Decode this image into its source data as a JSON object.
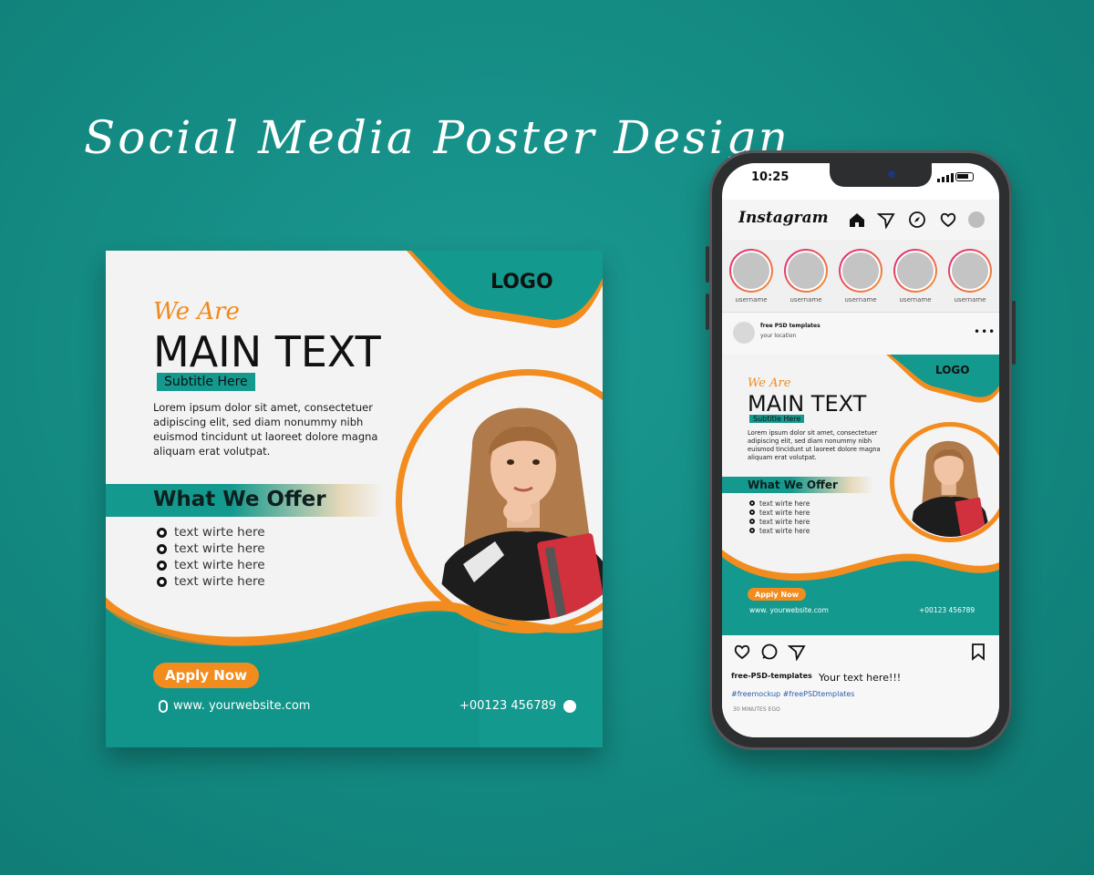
{
  "headline": "Social Media Poster Design",
  "poster": {
    "we_are": "We Are",
    "main_text": "MAIN TEXT",
    "subtitle": "Subtitle Here",
    "lorem": "Lorem ipsum dolor sit amet, consectetuer adipiscing elit, sed diam nonummy nibh euismod tincidunt ut laoreet dolore magna aliquam erat volutpat.",
    "offer_title": "What We Offer",
    "bullets": [
      "text wirte here",
      "text wirte here",
      "text wirte here",
      "text wirte here"
    ],
    "apply_label": "Apply Now",
    "website": "www. yourwebsite.com",
    "phone": "+00123 456789",
    "logo": "LOGO"
  },
  "phone": {
    "time": "10:25",
    "app_name": "Instagram",
    "stories": [
      "username",
      "username",
      "username",
      "username",
      "username"
    ],
    "post_author": "free PSD templates",
    "post_location": "your location",
    "caption_brand": "free-PSD-templates",
    "caption_text": "Your text here!!!",
    "hashtags": "#freemockup #freePSDtemplates",
    "timestamp": "30 MINUTES EGO"
  },
  "colors": {
    "teal": "#13998e",
    "orange": "#f28c1e",
    "background": "#138981"
  }
}
